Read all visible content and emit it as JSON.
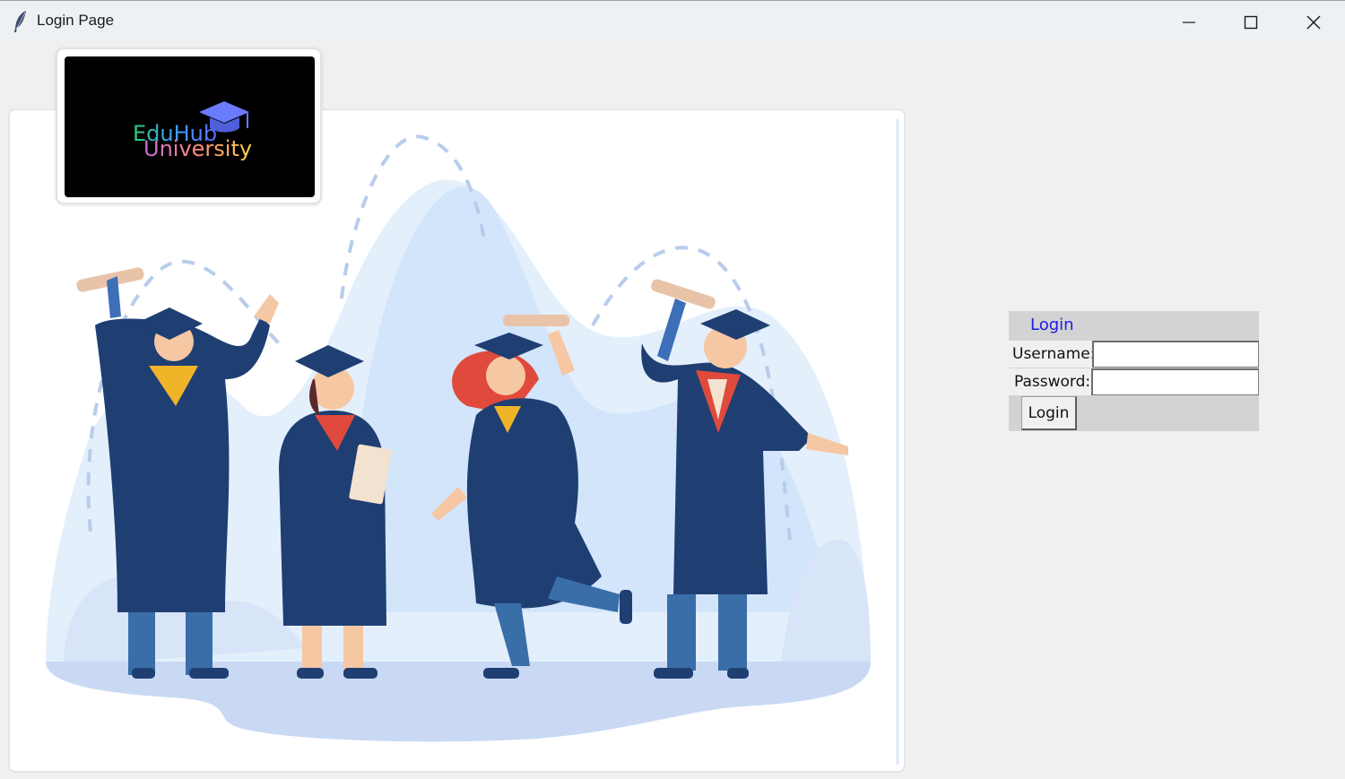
{
  "window": {
    "title": "Login Page",
    "controls": [
      "minimize",
      "maximize",
      "close"
    ]
  },
  "logo": {
    "line1": "EduHub",
    "line2": "University",
    "icon": "graduation-cap-icon"
  },
  "hero_image": {
    "subject": "graduates-illustration",
    "colors": {
      "gown": "#1f3f73",
      "pants": "#3a6ea8",
      "background": "#dbe9fb",
      "accent_red": "#e04a3c",
      "accent_gold": "#f0b429"
    }
  },
  "login": {
    "header": "Login",
    "username_label": "Username:",
    "username_value": "",
    "password_label": "Password:",
    "password_value": "",
    "button_label": "Login"
  },
  "colors": {
    "panel_bg": "#d3d3d3",
    "window_bg": "#f0f0f0",
    "header_text": "#1a1ae6"
  }
}
